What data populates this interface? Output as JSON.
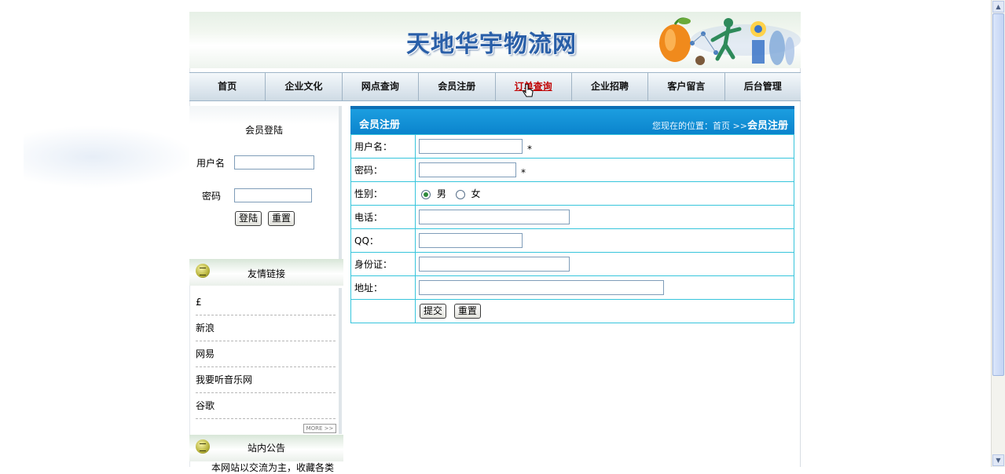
{
  "banner": {
    "title": "天地华宇物流网"
  },
  "nav": {
    "items": [
      "首页",
      "企业文化",
      "网点查询",
      "会员注册",
      "订单查询",
      "企业招聘",
      "客户留言",
      "后台管理"
    ],
    "active_index": 4
  },
  "login": {
    "title": "会员登陆",
    "username_label": "用户名",
    "password_label": "密码",
    "login_button": "登陆",
    "reset_button": "重置"
  },
  "friend_links": {
    "title": "友情链接",
    "items": [
      "£",
      "新浪",
      "网易",
      "我要听音乐网",
      "谷歌"
    ],
    "more": "MORE >>"
  },
  "notice": {
    "title": "站内公告",
    "text": "本网站以交流为主，收藏各类"
  },
  "register": {
    "title": "会员注册",
    "breadcrumb_prefix": "您现在的位置：首页 >>",
    "breadcrumb_current": "会员注册",
    "fields": {
      "username": "用户名：",
      "password": "密码：",
      "gender": "性别：",
      "phone": "电话：",
      "qq": "QQ：",
      "idcard": "身份证：",
      "address": "地址："
    },
    "required_mark": "*",
    "gender_options": [
      "男",
      "女"
    ],
    "gender_selected": "男",
    "submit_button": "提交",
    "reset_button": "重置"
  },
  "colors": {
    "panel_header": "#0a83cc",
    "table_border": "#37c5dc",
    "active_nav": "#c00000"
  }
}
